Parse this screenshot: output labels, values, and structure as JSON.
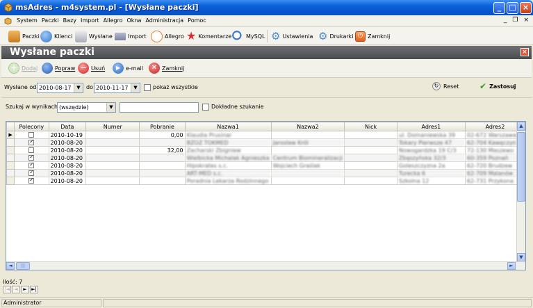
{
  "window": {
    "title": "msAdres - m4system.pl - [Wysłane paczki]",
    "buttons": {
      "minimize": "_",
      "maximize": "□",
      "close": "×"
    }
  },
  "menu": {
    "items": [
      "System",
      "Paczki",
      "Bazy",
      "Import",
      "Allegro",
      "Okna",
      "Administracja",
      "Pomoc"
    ],
    "mdi_minimize": "_",
    "mdi_restore": "❐",
    "mdi_close": "×"
  },
  "toolbar": {
    "items": [
      {
        "label": "Paczki",
        "icon": "package-icon",
        "color": "#d8903a"
      },
      {
        "label": "Klienci",
        "icon": "people-icon",
        "color": "#4a88d8"
      },
      {
        "label": "Wysłane",
        "icon": "send-icon",
        "color": "#9aa0a8"
      },
      {
        "label": "Import",
        "icon": "import-icon",
        "color": "#8a8fa8"
      },
      {
        "label": "Allegro",
        "icon": "hand-icon",
        "color": "#e88030"
      },
      {
        "label": "Komentarze",
        "icon": "star-icon",
        "color": "#d83030"
      },
      {
        "label": "MySQL",
        "icon": "database-search-icon",
        "color": "#3a7ad0"
      },
      {
        "label": "Ustawienia",
        "icon": "gear-icon",
        "color": "#4a8ad8"
      },
      {
        "label": "Drukarki",
        "icon": "printer-icon",
        "color": "#4a8ad8"
      },
      {
        "label": "Zamknij",
        "icon": "power-icon",
        "color": "#e06020"
      }
    ]
  },
  "form": {
    "title": "Wysłane paczki",
    "close": "×"
  },
  "actions": {
    "dodaj": "Dodaj",
    "popraw": "Popraw",
    "usun": "Usuń",
    "email": "e-mail",
    "zamknij": "Zamknij"
  },
  "filter": {
    "from_label": "Wysłane od",
    "from_value": "2010-08-17",
    "to_label": "do",
    "to_value": "2010-11-17",
    "show_all_label": "pokaż wszystkie",
    "show_all_checked": false,
    "reset_label": "Reset",
    "apply_label": "Zastosuj"
  },
  "search": {
    "label": "Szukaj w wynikach",
    "scope_value": "(wszędzie)",
    "query": "",
    "exact_label": "Dokładne szukanie",
    "exact_checked": false
  },
  "grid": {
    "columns": [
      "Polecony",
      "Data",
      "Numer",
      "Pobranie",
      "Nazwa1",
      "Nazwa2",
      "Nick",
      "Adres1",
      "Adres2"
    ],
    "rows": [
      {
        "polecony": false,
        "data": "2010-10-19",
        "numer": "",
        "pobranie": "0,00",
        "nazwa1": "Klaudia Prusinar",
        "nazwa2": "",
        "nick": "",
        "adres1": "ul. Domaniewska 39",
        "adres2": "02-672 Warszawa",
        "current": true
      },
      {
        "polecony": true,
        "data": "2010-08-20",
        "numer": "",
        "pobranie": "",
        "nazwa1": "BZOZ TOKMED",
        "nazwa2": "Jarosław Król",
        "nick": "",
        "adres1": "Tokary Pierwsze 47",
        "adres2": "62-704 Kawęczyn",
        "current": false
      },
      {
        "polecony": false,
        "data": "2010-08-20",
        "numer": "",
        "pobranie": "32,00",
        "nazwa1": "Zacharski Zbigniew",
        "nazwa2": "",
        "nick": "",
        "adres1": "Nowogardzka 19 C/3",
        "adres2": "72-130 Maszewo",
        "current": false
      },
      {
        "polecony": true,
        "data": "2010-08-20",
        "numer": "",
        "pobranie": "",
        "nazwa1": "Wielbicka Michalak Agnieszka",
        "nazwa2": "Centrum Biomineralizacji",
        "nick": "",
        "adres1": "Zbąszyńska 32/3",
        "adres2": "60-359 Poznań",
        "current": false
      },
      {
        "polecony": true,
        "data": "2010-08-20",
        "numer": "",
        "pobranie": "",
        "nazwa1": "Hipokrates s.c.",
        "nazwa2": "Wojciech Graślak",
        "nick": "",
        "adres1": "Goleszczyzna 2a",
        "adres2": "62-720 Brudzew",
        "current": false
      },
      {
        "polecony": true,
        "data": "2010-08-20",
        "numer": "",
        "pobranie": "",
        "nazwa1": "ART-MED s.c.",
        "nazwa2": "",
        "nick": "",
        "adres1": "Turecka 6",
        "adres2": "62-709 Malanów",
        "current": false
      },
      {
        "polecony": true,
        "data": "2010-08-20",
        "numer": "",
        "pobranie": "",
        "nazwa1": "Poradnia Lekarza Rodzinnego",
        "nazwa2": "",
        "nick": "",
        "adres1": "Szkolna 12",
        "adres2": "62-731 Przykona",
        "current": false
      }
    ]
  },
  "footer": {
    "count_label": "Ilość: 7",
    "pager": [
      "|◄",
      "◄",
      "►",
      "►|"
    ],
    "status_user": "Administrator"
  }
}
